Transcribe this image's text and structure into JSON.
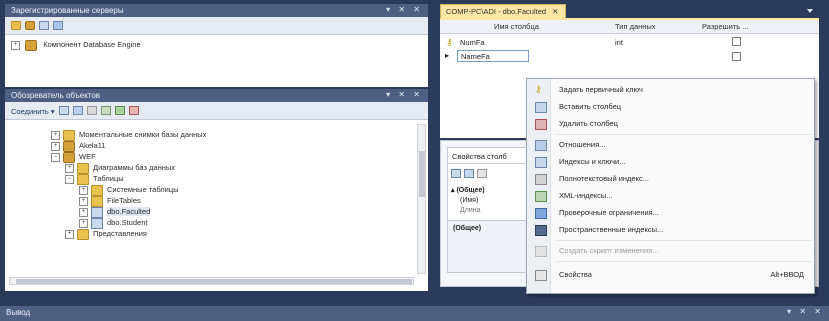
{
  "registered_servers": {
    "title": "Зарегистрированные серверы",
    "title_buttons": "▾ ✕ ✕",
    "tree_root": "Компонент Database Engine"
  },
  "object_explorer": {
    "title": "Обозреватель объектов",
    "title_buttons": "▾ ✕ ✕",
    "connect_label": "Соединить ▾",
    "tree": [
      "Моментальные снимки базы данных",
      "Akela11",
      "WEF",
      "Диаграммы баз данных",
      "Таблицы",
      "Системные таблицы",
      "FileTables",
      "dbo.Faculted",
      "dbo.Student",
      "Представления"
    ]
  },
  "designer": {
    "tab_label": "COMP-PC\\ADI - dbo.Faculted",
    "tab_close": "✕",
    "columns_header": [
      "Имя столбца",
      "Тип данных",
      "Разрешить ..."
    ],
    "rows": [
      {
        "name": "NumFa",
        "type": "int"
      },
      {
        "name": "NameFa",
        "type": ""
      }
    ],
    "properties_tab": "Свойства столб",
    "properties_rows": [
      "(Общее)",
      "(Имя)",
      "Длина"
    ],
    "properties_footer": "(Общее)"
  },
  "context_menu": {
    "items": [
      {
        "label": "Задать первичный ключ",
        "disabled": false
      },
      {
        "label": "Вставить столбец",
        "disabled": false
      },
      {
        "label": "Удалить столбец",
        "disabled": false
      },
      {
        "label": "Отношения...",
        "disabled": false
      },
      {
        "label": "Индексы и ключи...",
        "disabled": false
      },
      {
        "label": "Полнотекстовый индекс...",
        "disabled": false
      },
      {
        "label": "XML-индексы...",
        "disabled": false
      },
      {
        "label": "Проверочные ограничения...",
        "disabled": false
      },
      {
        "label": "Пространственные индексы...",
        "disabled": false
      },
      {
        "label": "Создать скрипт изменения...",
        "disabled": true
      },
      {
        "label": "Свойства",
        "shortcut": "Alt+ВВОД",
        "disabled": false
      }
    ]
  },
  "output_panel": {
    "title": "Вывод",
    "title_buttons": "▾ ✕ ✕"
  }
}
